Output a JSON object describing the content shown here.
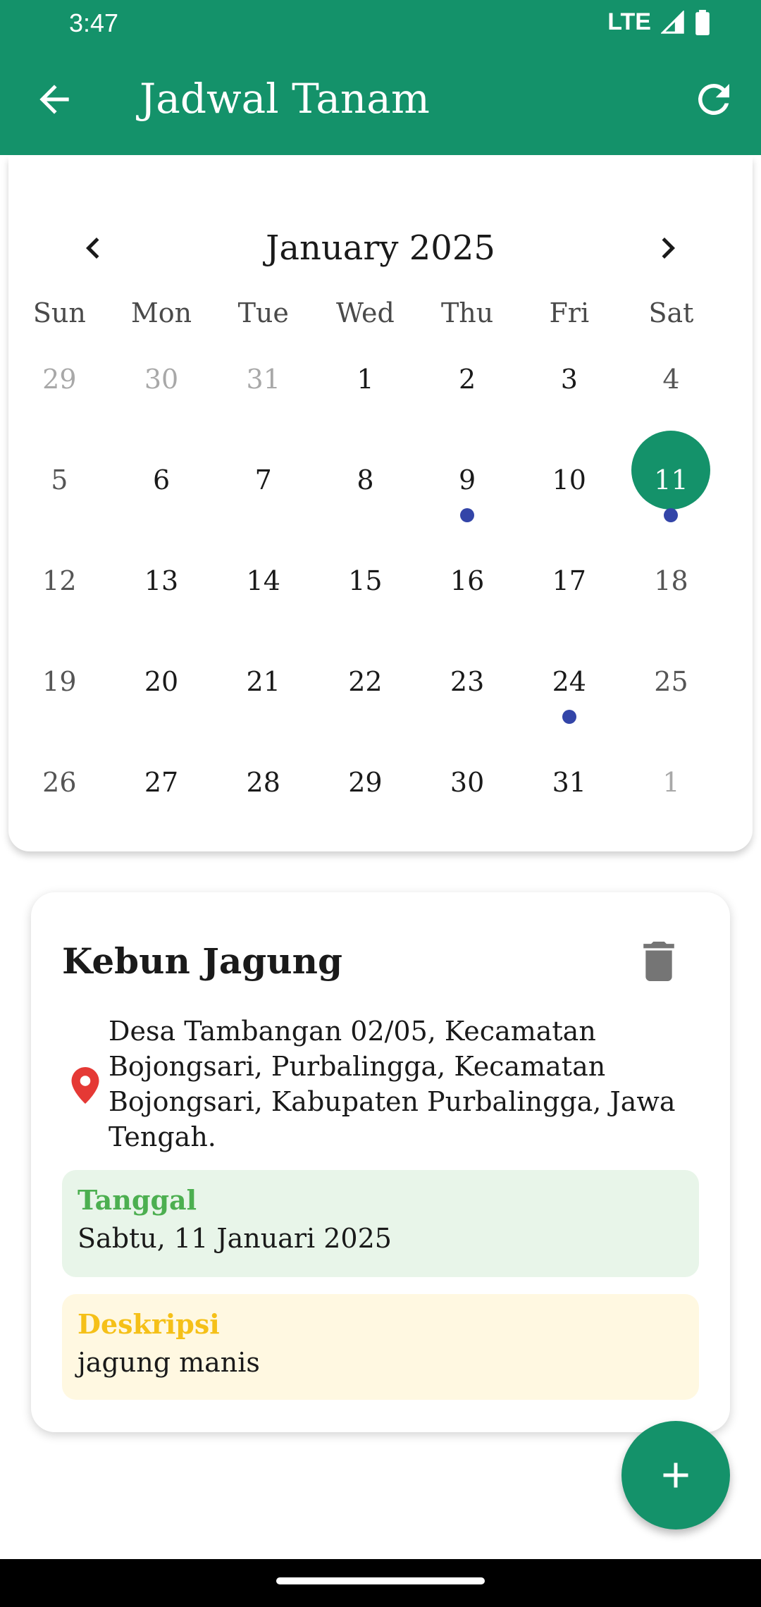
{
  "status_bar": {
    "time": "3:47",
    "network": "LTE"
  },
  "app_bar": {
    "title": "Jadwal Tanam"
  },
  "calendar": {
    "month_label": "January 2025",
    "weekdays": [
      "Sun",
      "Mon",
      "Tue",
      "Wed",
      "Thu",
      "Fri",
      "Sat"
    ],
    "days": [
      {
        "d": "29",
        "muted": true
      },
      {
        "d": "30",
        "muted": true
      },
      {
        "d": "31",
        "muted": true
      },
      {
        "d": "1"
      },
      {
        "d": "2"
      },
      {
        "d": "3"
      },
      {
        "d": "4",
        "weekend": true
      },
      {
        "d": "5",
        "weekend": true
      },
      {
        "d": "6"
      },
      {
        "d": "7"
      },
      {
        "d": "8"
      },
      {
        "d": "9",
        "event": true
      },
      {
        "d": "10"
      },
      {
        "d": "11",
        "selected": true,
        "event": true
      },
      {
        "d": "12",
        "weekend": true
      },
      {
        "d": "13"
      },
      {
        "d": "14"
      },
      {
        "d": "15"
      },
      {
        "d": "16"
      },
      {
        "d": "17"
      },
      {
        "d": "18",
        "weekend": true
      },
      {
        "d": "19",
        "weekend": true
      },
      {
        "d": "20"
      },
      {
        "d": "21"
      },
      {
        "d": "22"
      },
      {
        "d": "23"
      },
      {
        "d": "24",
        "event": true
      },
      {
        "d": "25",
        "weekend": true
      },
      {
        "d": "26",
        "weekend": true
      },
      {
        "d": "27"
      },
      {
        "d": "28"
      },
      {
        "d": "29"
      },
      {
        "d": "30"
      },
      {
        "d": "31"
      },
      {
        "d": "1",
        "muted": true
      }
    ]
  },
  "event": {
    "name": "Kebun Jagung",
    "address": "Desa Tambangan 02/05, Kecamatan Bojongsari, Purbalingga, Kecamatan Bojongsari, Kabupaten Purbalingga, Jawa Tengah.",
    "date_label": "Tanggal",
    "date_value": "Sabtu, 11 Januari 2025",
    "desc_label": "Deskripsi",
    "desc_value": "jagung manis"
  },
  "colors": {
    "primary": "#14926a",
    "event_dot": "#3345a8",
    "pin": "#e53935"
  },
  "icons": {
    "back": "arrow-left-icon",
    "refresh": "refresh-icon",
    "prev": "chevron-left-icon",
    "next": "chevron-right-icon",
    "delete": "trash-icon",
    "location": "map-pin-icon",
    "add": "plus-icon"
  }
}
